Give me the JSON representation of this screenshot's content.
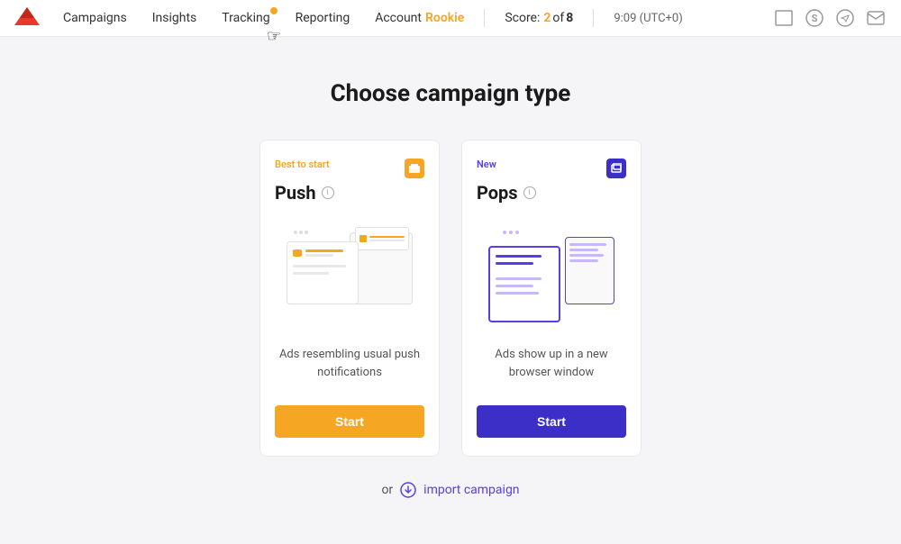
{
  "nav": {
    "logo_alt": "Logo",
    "links": [
      {
        "label": "Campaigns",
        "id": "campaigns",
        "badge": false
      },
      {
        "label": "Insights",
        "id": "insights",
        "badge": false
      },
      {
        "label": "Tracking",
        "id": "tracking",
        "badge": true
      },
      {
        "label": "Reporting",
        "id": "reporting",
        "badge": false
      },
      {
        "label": "Account",
        "id": "account",
        "badge": false
      },
      {
        "label": "Rookie",
        "id": "account-rank",
        "badge": false
      }
    ],
    "score_label": "Score:",
    "score_value": "2",
    "score_total": "8",
    "time": "9:09 (UTC+0)"
  },
  "page": {
    "title": "Choose campaign type"
  },
  "cards": [
    {
      "id": "push",
      "badge": "Best to start",
      "badge_class": "orange",
      "icon_class": "orange",
      "title": "Push",
      "description": "Ads resembling usual push notifications",
      "btn_label": "Start",
      "btn_class": "orange"
    },
    {
      "id": "pops",
      "badge": "New",
      "badge_class": "purple",
      "icon_class": "purple",
      "title": "Pops",
      "description": "Ads show up in a new browser window",
      "btn_label": "Start",
      "btn_class": "purple"
    }
  ],
  "import": {
    "or_label": "or",
    "link_label": "import campaign"
  }
}
